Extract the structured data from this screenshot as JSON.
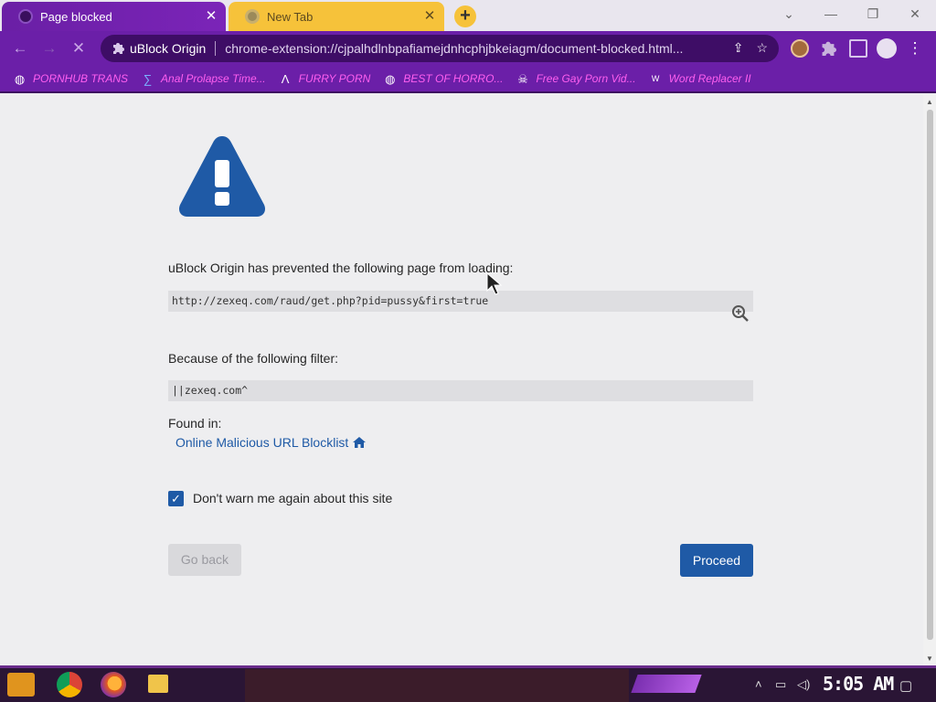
{
  "tabs": [
    {
      "title": "Page blocked",
      "close": "✕",
      "active": true
    },
    {
      "title": "New Tab",
      "close": "✕",
      "active": false
    }
  ],
  "new_tab_symbol": "+",
  "window_controls": {
    "minimize": "—",
    "restore": "❐",
    "close": "✕",
    "tab_search": "⌄"
  },
  "nav": {
    "back": "←",
    "forward": "→",
    "reload": "✕"
  },
  "omnibox": {
    "site_name": "uBlock Origin",
    "url": "chrome-extension://cjpalhdlnbpafiamejdnhcphjbkeiagm/document-blocked.html...",
    "share_icon": "⇪",
    "bookmark_icon": "☆"
  },
  "bookmarks": [
    {
      "label": "PORNHUB TRANS",
      "icon": "globe-icon"
    },
    {
      "label": "Anal Prolapse Time...",
      "icon": "bracket-icon"
    },
    {
      "label": "FURRY PORN",
      "icon": "lambda-icon"
    },
    {
      "label": "BEST OF HORRO...",
      "icon": "globe-icon"
    },
    {
      "label": "Free Gay Porn Vid...",
      "icon": "skull-icon"
    },
    {
      "label": "Word Replacer II",
      "icon": "wr-icon"
    }
  ],
  "blocked_page": {
    "message": "uBlock Origin has prevented the following page from loading:",
    "blocked_url": "http://zexeq.com/raud/get.php?pid=pussy&first=true",
    "filter_label": "Because of the following filter:",
    "filter": "||zexeq.com^",
    "found_in_label": "Found in:",
    "found_in_list": "Online Malicious URL Blocklist",
    "dont_warn_label": "Don't warn me again about this site",
    "dont_warn_checked": true,
    "go_back_label": "Go back",
    "proceed_label": "Proceed"
  },
  "taskbar": {
    "clock": "5:05 AM"
  },
  "colors": {
    "accent_blue": "#1f5aa6",
    "toolbar_purple": "#6b1fa8",
    "bookmark_pink": "#ff5ff0",
    "tab_yellow": "#f6c23a"
  }
}
